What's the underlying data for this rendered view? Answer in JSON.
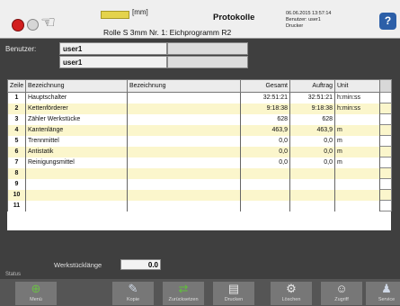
{
  "header": {
    "unit": "[mm]",
    "title": "Protokolle",
    "subtitle": "Rolle S 3mm Nr. 1: Eichprogramm R2",
    "datetime": "06.06.2015 13:57:14\nBenutzer: user1\nDrucker",
    "help": "?"
  },
  "user": {
    "label": "Benutzer:",
    "values": [
      "user1",
      "user1"
    ]
  },
  "table": {
    "columns": [
      "Zeile",
      "Bezeichnung",
      "Bezeichnung",
      "Gesamt",
      "Auftrag",
      "Unit"
    ],
    "rows": [
      {
        "idx": "1",
        "name": "Hauptschalter",
        "b2": "",
        "gesamt": "32:51:21",
        "auftrag": "32:51:21",
        "unit": "h:min:ss"
      },
      {
        "idx": "2",
        "name": "Kettenförderer",
        "b2": "",
        "gesamt": "9:18:38",
        "auftrag": "9:18:38",
        "unit": "h:min:ss"
      },
      {
        "idx": "3",
        "name": "Zähler Werkstücke",
        "b2": "",
        "gesamt": "628",
        "auftrag": "628",
        "unit": ""
      },
      {
        "idx": "4",
        "name": "Kantenlänge",
        "b2": "",
        "gesamt": "463,9",
        "auftrag": "463,9",
        "unit": "m"
      },
      {
        "idx": "5",
        "name": "Trennmittel",
        "b2": "",
        "gesamt": "0,0",
        "auftrag": "0,0",
        "unit": "m"
      },
      {
        "idx": "6",
        "name": "Antistatik",
        "b2": "",
        "gesamt": "0,0",
        "auftrag": "0,0",
        "unit": "m"
      },
      {
        "idx": "7",
        "name": "Reinigungsmittel",
        "b2": "",
        "gesamt": "0,0",
        "auftrag": "0,0",
        "unit": "m"
      },
      {
        "idx": "8",
        "name": "",
        "b2": "",
        "gesamt": "",
        "auftrag": "",
        "unit": ""
      },
      {
        "idx": "9",
        "name": "",
        "b2": "",
        "gesamt": "",
        "auftrag": "",
        "unit": ""
      },
      {
        "idx": "10",
        "name": "",
        "b2": "",
        "gesamt": "",
        "auftrag": "",
        "unit": ""
      },
      {
        "idx": "11",
        "name": "",
        "b2": "",
        "gesamt": "",
        "auftrag": "",
        "unit": ""
      }
    ]
  },
  "werkstueck": {
    "label": "Werkstücklänge",
    "value": "0.0"
  },
  "status_label": "Status",
  "toolbar": [
    {
      "label": "Menü",
      "icon": "plus-circle-icon",
      "color": "#6bbf45"
    },
    {
      "label": "Kopie",
      "icon": "wrench-icon",
      "color": "#cfd8e6"
    },
    {
      "label": "Zurücksetzen",
      "icon": "arrows-icon",
      "color": "#5fbf3a"
    },
    {
      "label": "Drucken",
      "icon": "document-icon",
      "color": "#e8e8e8"
    },
    {
      "label": "Löschen",
      "icon": "tools-icon",
      "color": "#e8e8e8"
    },
    {
      "label": "Zugriff",
      "icon": "users-icon",
      "color": "#e8e8e8"
    },
    {
      "label": "Service",
      "icon": "person-icon",
      "color": "#cfd8e6"
    }
  ]
}
